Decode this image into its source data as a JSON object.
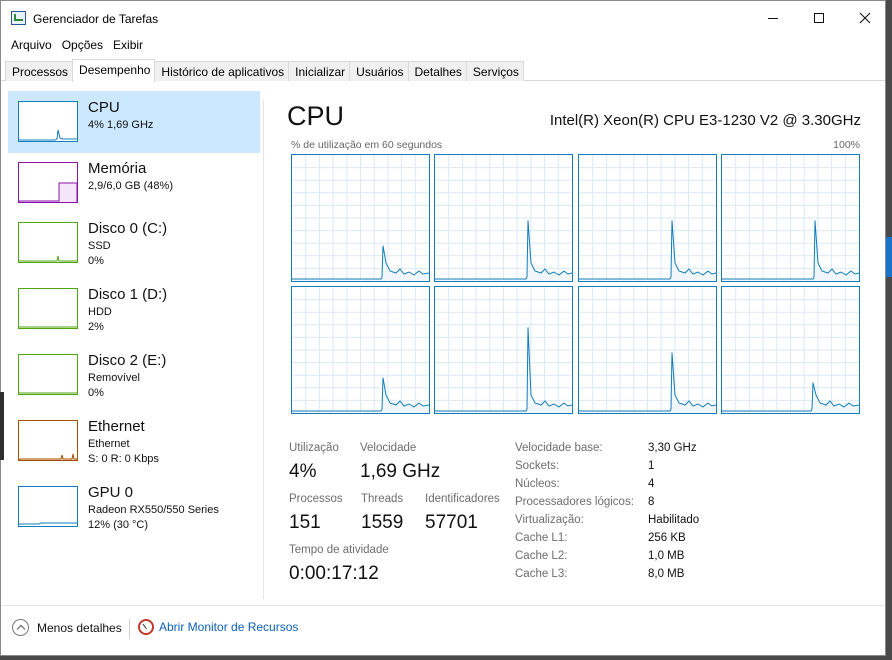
{
  "window": {
    "title": "Gerenciador de Tarefas"
  },
  "menu": [
    "Arquivo",
    "Opções",
    "Exibir"
  ],
  "tabs": [
    {
      "label": "Processos",
      "active": false
    },
    {
      "label": "Desempenho",
      "active": true
    },
    {
      "label": "Histórico de aplicativos",
      "active": false
    },
    {
      "label": "Inicializar",
      "active": false
    },
    {
      "label": "Usuários",
      "active": false
    },
    {
      "label": "Detalhes",
      "active": false
    },
    {
      "label": "Serviços",
      "active": false
    }
  ],
  "sidebar": {
    "items": [
      {
        "name": "CPU",
        "line1": "4% 1,69 GHz",
        "line2": "",
        "color": "#117dbb",
        "selected": true
      },
      {
        "name": "Memória",
        "line1": "2,9/6,0 GB (48%)",
        "line2": "",
        "color": "#8b12ae",
        "selected": false
      },
      {
        "name": "Disco 0 (C:)",
        "line1": "SSD",
        "line2": "0%",
        "color": "#4da60c",
        "selected": false
      },
      {
        "name": "Disco 1 (D:)",
        "line1": "HDD",
        "line2": "2%",
        "color": "#4da60c",
        "selected": false
      },
      {
        "name": "Disco 2 (E:)",
        "line1": "Removível",
        "line2": "0%",
        "color": "#4da60c",
        "selected": false
      },
      {
        "name": "Ethernet",
        "line1": "Ethernet",
        "line2": "S: 0 R: 0 Kbps",
        "color": "#a74f01",
        "selected": false
      },
      {
        "name": "GPU 0",
        "line1": "Radeon RX550/550 Series",
        "line2": "12% (30 °C)",
        "color": "#117dbb",
        "selected": false
      }
    ]
  },
  "main": {
    "title": "CPU",
    "model": "Intel(R) Xeon(R) CPU E3-1230 V2 @ 3.30GHz",
    "util_label": "% de utilização em 60 segundos",
    "util_max": "100%",
    "graph_color": "#117dbb",
    "core_graphs": 8,
    "stats": {
      "utilizacao_label": "Utilização",
      "utilizacao_value": "4%",
      "velocidade_label": "Velocidade",
      "velocidade_value": "1,69 GHz",
      "processos_label": "Processos",
      "processos_value": "151",
      "threads_label": "Threads",
      "threads_value": "1559",
      "identificadores_label": "Identificadores",
      "identificadores_value": "57701",
      "tempo_label": "Tempo de atividade",
      "tempo_value": "0:00:17:12"
    },
    "details": [
      {
        "key": "Velocidade base:",
        "value": "3,30 GHz"
      },
      {
        "key": "Sockets:",
        "value": "1"
      },
      {
        "key": "Núcleos:",
        "value": "4"
      },
      {
        "key": "Processadores lógicos:",
        "value": "8"
      },
      {
        "key": "Virtualização:",
        "value": "Habilitado"
      },
      {
        "key": "Cache L1:",
        "value": "256 KB"
      },
      {
        "key": "Cache L2:",
        "value": "1,0 MB"
      },
      {
        "key": "Cache L3:",
        "value": "8,0 MB"
      }
    ]
  },
  "footer": {
    "less_details": "Menos detalhes",
    "open_monitor": "Abrir Monitor de Recursos"
  }
}
